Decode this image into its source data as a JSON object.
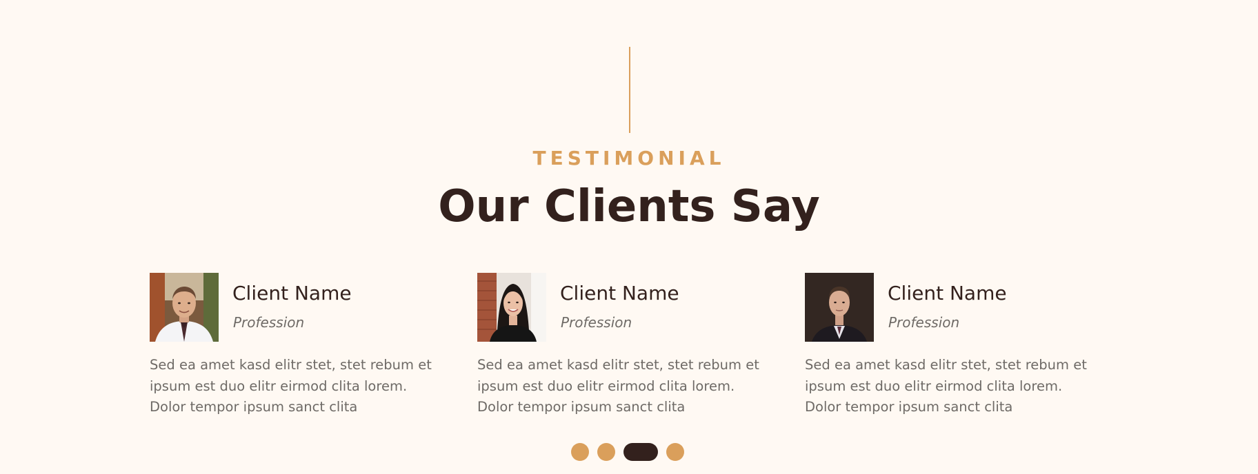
{
  "section": {
    "kicker": "TESTIMONIAL",
    "title": "Our Clients Say"
  },
  "testimonials": [
    {
      "name": "Client Name",
      "profession": "Profession",
      "text": "Sed ea amet kasd elitr stet, stet rebum et ipsum est duo elitr eirmod clita lorem. Dolor tempor ipsum sanct clita",
      "avatar_icon": "avatar-photo-man-tie"
    },
    {
      "name": "Client Name",
      "profession": "Profession",
      "text": "Sed ea amet kasd elitr stet, stet rebum et ipsum est duo elitr eirmod clita lorem. Dolor tempor ipsum sanct clita",
      "avatar_icon": "avatar-photo-woman"
    },
    {
      "name": "Client Name",
      "profession": "Profession",
      "text": "Sed ea amet kasd elitr stet, stet rebum et ipsum est duo elitr eirmod clita lorem. Dolor tempor ipsum sanct clita",
      "avatar_icon": "avatar-photo-man-suit"
    }
  ],
  "carousel": {
    "dot_count": 4,
    "active_index": 2
  },
  "colors": {
    "background": "#FFF9F3",
    "accent": "#DA9F5B",
    "dark": "#33211D",
    "muted_text": "#6E6A66"
  }
}
